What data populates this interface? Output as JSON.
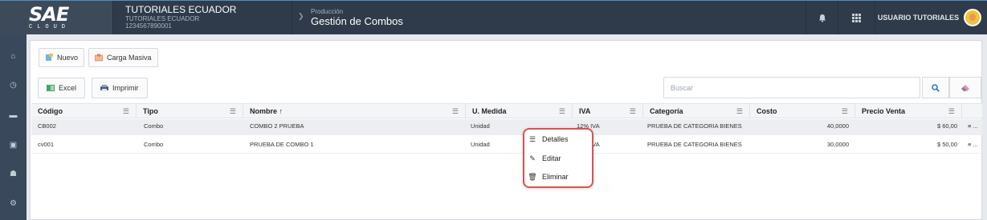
{
  "app": {
    "logo": "SAE",
    "logo_sub": "CLOUD",
    "company_name": "TUTORIALES ECUADOR",
    "company_sub": "TUTORIALES ECUADOR",
    "company_ruc": "1234567890001",
    "breadcrumb_parent": "Producción",
    "breadcrumb_title": "Gestión de Combos",
    "user_label": "USUARIO TUTORIALES"
  },
  "sidebar": {
    "items": [
      {
        "icon": "home-icon",
        "glyph": "⌂"
      },
      {
        "icon": "clock-icon",
        "glyph": "◷"
      },
      {
        "icon": "chart-icon",
        "glyph": "▬"
      },
      {
        "icon": "document-icon",
        "glyph": "▣"
      },
      {
        "icon": "users-icon",
        "glyph": "☗"
      },
      {
        "icon": "settings-icon",
        "glyph": "⚙"
      }
    ]
  },
  "toolbar": {
    "new_label": "Nuevo",
    "bulk_label": "Carga Masiva",
    "excel_label": "Excel",
    "print_label": "Imprimir",
    "search_placeholder": "Buscar"
  },
  "table": {
    "headers": [
      "Código",
      "Tipo",
      "Nombre ↑",
      "U. Medida",
      "IVA",
      "Categoría",
      "Costo",
      "Precio Venta"
    ],
    "rows": [
      {
        "codigo": "CB002",
        "tipo": "Combo",
        "nombre": "COMBO 2 PRUEBA",
        "medida": "Unidad",
        "iva": "12% IVA",
        "categoria": "PRUEBA DE CATEGORIA BIENES",
        "costo": "40,0000",
        "precio": "$ 60,00",
        "actions": "≡ ..."
      },
      {
        "codigo": "cv001",
        "tipo": "Combo",
        "nombre": "PRUEBA DE COMBO 1",
        "medida": "Unidad",
        "iva": "12% IVA",
        "categoria": "PRUEBA DE CATEGORIA BIENES",
        "costo": "30,0000",
        "precio": "$ 50,00",
        "actions": "≡ ..."
      }
    ]
  },
  "context_menu": {
    "items": [
      {
        "label": "Detalles",
        "icon": "list-icon"
      },
      {
        "label": "Editar",
        "icon": "pencil-icon"
      },
      {
        "label": "Eliminar",
        "icon": "trash-icon"
      }
    ]
  },
  "colors": {
    "topbar": "#2f3b4a",
    "sidebar": "#39485a",
    "menu_highlight": "#d9534f",
    "search_accent": "#2f78c4"
  }
}
